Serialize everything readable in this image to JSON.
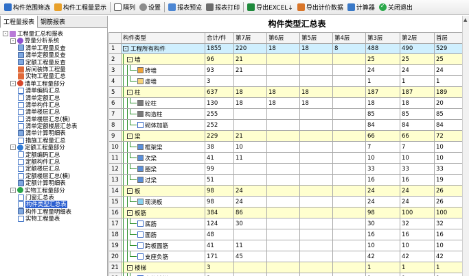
{
  "toolbar": {
    "items": [
      {
        "name": "range-filter-button",
        "icon": "funnel-grid-icon",
        "label": "构件范围筛选"
      },
      {
        "name": "quantity-display-button",
        "icon": "pencil-chart-icon",
        "label": "构件工程量显示"
      },
      {
        "name": "column-button",
        "icon": "column-icon",
        "label": "隔列"
      },
      {
        "name": "settings-button",
        "icon": "gear-icon",
        "label": "设置"
      },
      {
        "name": "report-preview-button",
        "icon": "preview-icon",
        "label": "报表预览"
      },
      {
        "name": "report-print-button",
        "icon": "printer-icon",
        "label": "报表打印"
      },
      {
        "name": "export-excel-button",
        "icon": "excel-icon",
        "label": "导出EXCEL↓"
      },
      {
        "name": "export-price-data-button",
        "icon": "export-people-icon",
        "label": "导出计价数据"
      },
      {
        "name": "calculator-button",
        "icon": "calculator-icon",
        "label": "计算器"
      },
      {
        "name": "close-exit-button",
        "icon": "check-circle-icon",
        "label": "关闭退出"
      }
    ]
  },
  "left_panel": {
    "tabs": [
      "工程量报表",
      "钢筋报表"
    ],
    "tree": [
      {
        "depth": 0,
        "exp": "-",
        "icon": "root",
        "label": "工程量汇总和报表"
      },
      {
        "depth": 1,
        "exp": "-",
        "icon": "circle-purple",
        "label": "算量分析系统"
      },
      {
        "depth": 2,
        "exp": "",
        "icon": "pen",
        "label": "清单工程量反查"
      },
      {
        "depth": 2,
        "exp": "",
        "icon": "pen",
        "label": "清单定额量反查"
      },
      {
        "depth": 2,
        "exp": "",
        "icon": "pen",
        "label": "定额工程量反查"
      },
      {
        "depth": 2,
        "exp": "",
        "icon": "house",
        "label": "房间装饰工程量"
      },
      {
        "depth": 2,
        "exp": "",
        "icon": "house",
        "label": "实物工程量汇总"
      },
      {
        "depth": 1,
        "exp": "-",
        "icon": "circle-red",
        "label": "清单工程量部分"
      },
      {
        "depth": 2,
        "exp": "",
        "icon": "grid-blue",
        "label": "清单编码汇总"
      },
      {
        "depth": 2,
        "exp": "",
        "icon": "grid-blue",
        "label": "清单定额汇总"
      },
      {
        "depth": 2,
        "exp": "",
        "icon": "grid-blue",
        "label": "清单构件汇总"
      },
      {
        "depth": 2,
        "exp": "",
        "icon": "grid-blue",
        "label": "清单楼层汇总"
      },
      {
        "depth": 2,
        "exp": "",
        "icon": "grid-blue",
        "label": "清单楼层汇总(横)"
      },
      {
        "depth": 2,
        "exp": "",
        "icon": "grid-blue",
        "label": "清单定额楼层汇总表"
      },
      {
        "depth": 2,
        "exp": "",
        "icon": "pen",
        "label": "清单计算明细表"
      },
      {
        "depth": 2,
        "exp": "",
        "icon": "grid-blue",
        "label": "措施工程量汇总"
      },
      {
        "depth": 1,
        "exp": "-",
        "icon": "circle-blue",
        "label": "定额工程量部分"
      },
      {
        "depth": 2,
        "exp": "",
        "icon": "grid-blue",
        "label": "定额编码汇总"
      },
      {
        "depth": 2,
        "exp": "",
        "icon": "grid-blue",
        "label": "定额构件汇总"
      },
      {
        "depth": 2,
        "exp": "",
        "icon": "grid-blue",
        "label": "定额楼层汇总"
      },
      {
        "depth": 2,
        "exp": "",
        "icon": "grid-blue",
        "label": "定额楼层汇总(横)"
      },
      {
        "depth": 2,
        "exp": "",
        "icon": "pen",
        "label": "定额计算明细表"
      },
      {
        "depth": 1,
        "exp": "-",
        "icon": "circle-green",
        "label": "实物工程量部分"
      },
      {
        "depth": 2,
        "exp": "",
        "icon": "grid-blue",
        "label": "门窗汇总表"
      },
      {
        "depth": 2,
        "exp": "",
        "icon": "grid-blue",
        "label": "构件类型汇总表",
        "selected": true
      },
      {
        "depth": 2,
        "exp": "",
        "icon": "pen",
        "label": "构件工程量明细表"
      },
      {
        "depth": 2,
        "exp": "",
        "icon": "grid-blue",
        "label": "实物工程量表"
      }
    ]
  },
  "report": {
    "title": "构件类型汇总表",
    "columns": [
      "构件类型",
      "合计/件",
      "第7层",
      "第6层",
      "第5层",
      "第4层",
      "第3层",
      "第2层",
      "首层"
    ],
    "rows": [
      {
        "n": "1",
        "depth": 0,
        "box": "-",
        "icon": "",
        "label": "工程所有构件",
        "vals": [
          "1855",
          "220",
          "18",
          "18",
          "8",
          "488",
          "490",
          "529"
        ],
        "style": "root"
      },
      {
        "n": "2",
        "depth": 1,
        "box": "-",
        "icon": "",
        "label": "墙",
        "vals": [
          "96",
          "21",
          "",
          "",
          "",
          "25",
          "25",
          "25"
        ],
        "style": "hl"
      },
      {
        "n": "3",
        "depth": 2,
        "box": "",
        "icon": "wall",
        "label": "砖墙",
        "vals": [
          "93",
          "21",
          "",
          "",
          "",
          "24",
          "24",
          "24"
        ],
        "style": ""
      },
      {
        "n": "4",
        "depth": 2,
        "box": "",
        "icon": "wall2",
        "label": "虚墙",
        "vals": [
          "3",
          "",
          "",
          "",
          "",
          "1",
          "1",
          "1"
        ],
        "style": ""
      },
      {
        "n": "5",
        "depth": 1,
        "box": "-",
        "icon": "",
        "label": "柱",
        "vals": [
          "637",
          "18",
          "18",
          "18",
          "",
          "187",
          "187",
          "189"
        ],
        "style": "hl"
      },
      {
        "n": "6",
        "depth": 2,
        "box": "",
        "icon": "col",
        "label": "砼柱",
        "vals": [
          "130",
          "18",
          "18",
          "18",
          "",
          "18",
          "18",
          "20"
        ],
        "style": ""
      },
      {
        "n": "7",
        "depth": 2,
        "box": "",
        "icon": "col",
        "label": "构造柱",
        "vals": [
          "255",
          "",
          "",
          "",
          "",
          "85",
          "85",
          "85"
        ],
        "style": ""
      },
      {
        "n": "8",
        "depth": 2,
        "box": "",
        "icon": "bar",
        "label": "砌体加筋",
        "vals": [
          "252",
          "",
          "",
          "",
          "",
          "84",
          "84",
          "84"
        ],
        "style": ""
      },
      {
        "n": "9",
        "depth": 1,
        "box": "-",
        "icon": "",
        "label": "梁",
        "vals": [
          "229",
          "21",
          "",
          "",
          "",
          "66",
          "66",
          "72"
        ],
        "style": "hl"
      },
      {
        "n": "10",
        "depth": 2,
        "box": "",
        "icon": "beam",
        "label": "框架梁",
        "vals": [
          "38",
          "10",
          "",
          "",
          "",
          "7",
          "7",
          "10"
        ],
        "style": ""
      },
      {
        "n": "11",
        "depth": 2,
        "box": "",
        "icon": "beam",
        "label": "次梁",
        "vals": [
          "41",
          "11",
          "",
          "",
          "",
          "10",
          "10",
          "10"
        ],
        "style": ""
      },
      {
        "n": "12",
        "depth": 2,
        "box": "",
        "icon": "beam",
        "label": "圈梁",
        "vals": [
          "99",
          "",
          "",
          "",
          "",
          "33",
          "33",
          "33"
        ],
        "style": ""
      },
      {
        "n": "13",
        "depth": 2,
        "box": "",
        "icon": "beam",
        "label": "过梁",
        "vals": [
          "51",
          "",
          "",
          "",
          "",
          "16",
          "16",
          "19"
        ],
        "style": ""
      },
      {
        "n": "14",
        "depth": 1,
        "box": "-",
        "icon": "",
        "label": "板",
        "vals": [
          "98",
          "24",
          "",
          "",
          "",
          "24",
          "24",
          "26"
        ],
        "style": "hl"
      },
      {
        "n": "15",
        "depth": 2,
        "box": "",
        "icon": "slab",
        "label": "现浇板",
        "vals": [
          "98",
          "24",
          "",
          "",
          "",
          "24",
          "24",
          "26"
        ],
        "style": ""
      },
      {
        "n": "16",
        "depth": 1,
        "box": "-",
        "icon": "",
        "label": "板筋",
        "vals": [
          "384",
          "86",
          "",
          "",
          "",
          "98",
          "100",
          "100"
        ],
        "style": "hl"
      },
      {
        "n": "17",
        "depth": 2,
        "box": "",
        "icon": "bar",
        "label": "底筋",
        "vals": [
          "124",
          "30",
          "",
          "",
          "",
          "30",
          "32",
          "32"
        ],
        "style": ""
      },
      {
        "n": "18",
        "depth": 2,
        "box": "",
        "icon": "bar",
        "label": "面筋",
        "vals": [
          "48",
          "",
          "",
          "",
          "",
          "16",
          "16",
          "16"
        ],
        "style": ""
      },
      {
        "n": "19",
        "depth": 2,
        "box": "",
        "icon": "bar",
        "label": "跨板面筋",
        "vals": [
          "41",
          "11",
          "",
          "",
          "",
          "10",
          "10",
          "10"
        ],
        "style": ""
      },
      {
        "n": "20",
        "depth": 2,
        "box": "",
        "icon": "bar",
        "label": "支座负筋",
        "vals": [
          "171",
          "45",
          "",
          "",
          "",
          "42",
          "42",
          "42"
        ],
        "style": ""
      },
      {
        "n": "21",
        "depth": 1,
        "box": "-",
        "icon": "",
        "label": "楼梯",
        "vals": [
          "3",
          "",
          "",
          "",
          "",
          "1",
          "1",
          "1"
        ],
        "style": "hl"
      },
      {
        "n": "22",
        "depth": 2,
        "box": "",
        "icon": "stair",
        "label": "参数楼梯",
        "vals": [
          "3",
          "",
          "",
          "",
          "",
          "1",
          "1",
          "1"
        ],
        "style": ""
      }
    ]
  }
}
